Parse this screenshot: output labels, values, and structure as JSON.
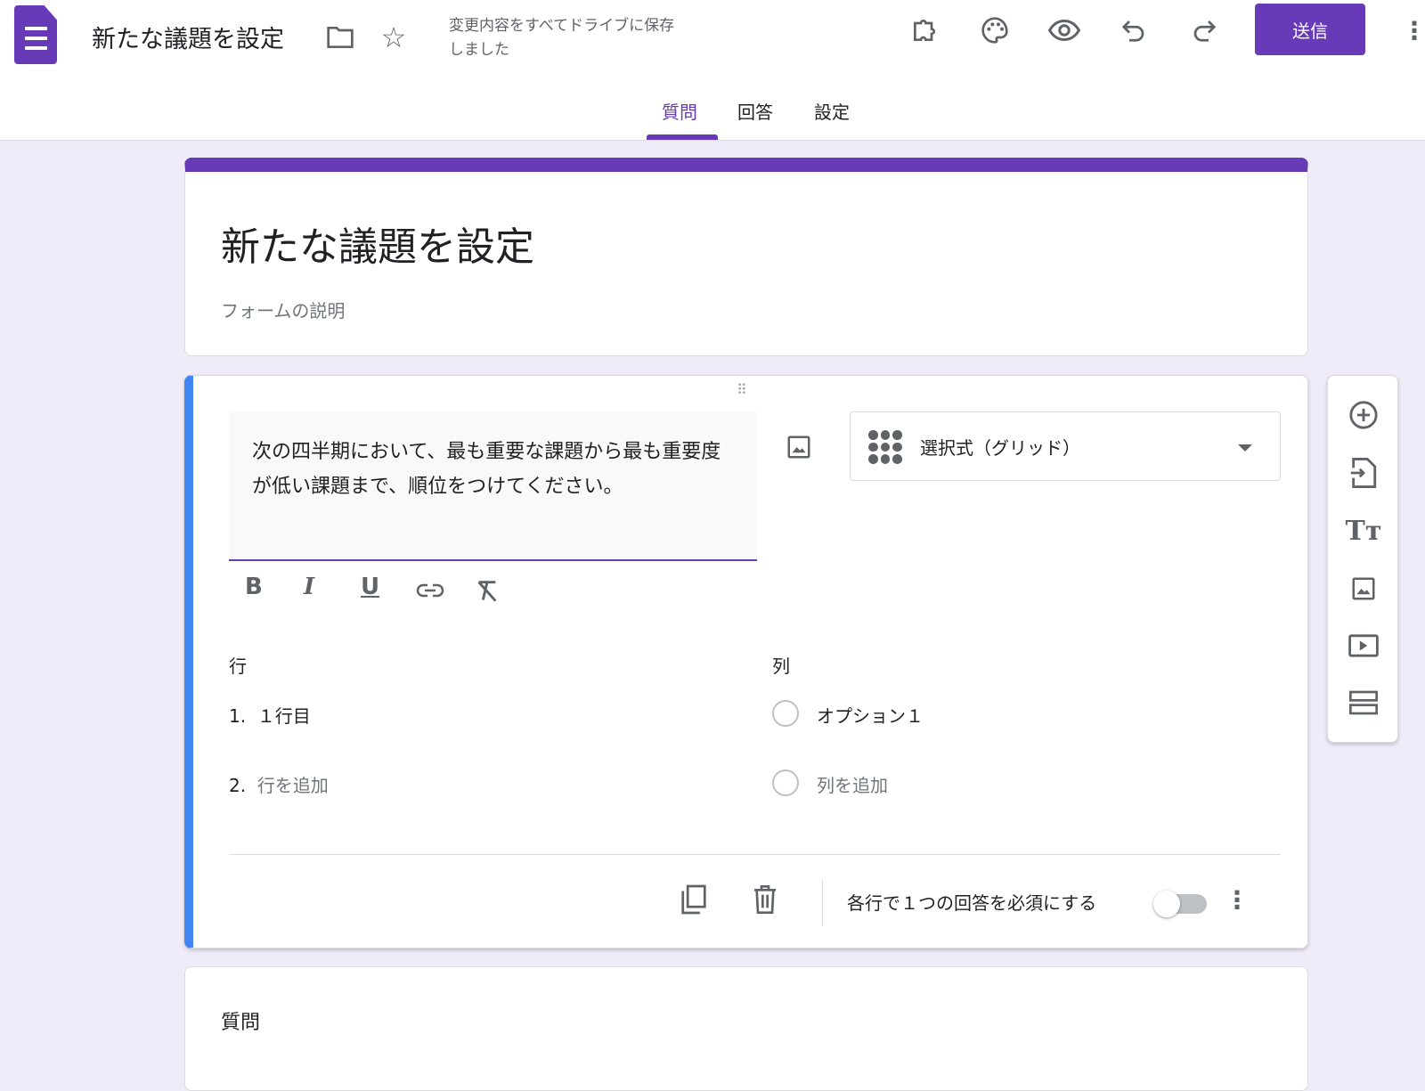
{
  "header": {
    "title": "新たな議題を設定",
    "save_status": "変更内容をすべてドライブに保存しました",
    "send_label": "送信"
  },
  "tabs": [
    "質問",
    "回答",
    "設定"
  ],
  "form": {
    "title": "新たな議題を設定",
    "description_placeholder": "フォームの説明"
  },
  "question": {
    "text": "次の四半期において、最も重要な課題から最も重要度が低い課題まで、順位をつけてください。",
    "type": "選択式（グリッド）",
    "rows_label": "行",
    "cols_label": "列",
    "rows": [
      {
        "num": "1.",
        "label": "１行目"
      },
      {
        "num": "2.",
        "label": "行を追加"
      }
    ],
    "cols": [
      "オプション１",
      "列を追加"
    ],
    "required_label": "各行で１つの回答を必須にする",
    "required": false
  },
  "next_question": {
    "label": "質問"
  },
  "colors": {
    "accent": "#673ab7",
    "active_border": "#4285f4",
    "background": "#f0ebf8"
  }
}
